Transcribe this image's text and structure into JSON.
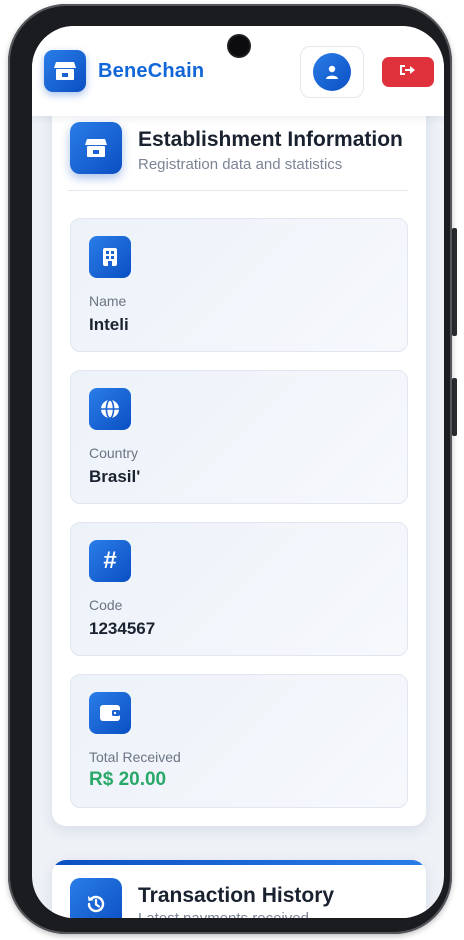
{
  "header": {
    "brand": "BeneChain",
    "logo_icon": "store-icon",
    "profile_icon": "user-icon",
    "logout_icon": "logout-icon"
  },
  "establishment": {
    "title": "Establishment Information",
    "subtitle": "Registration data and statistics",
    "fields": [
      {
        "label": "Name",
        "value": "Inteli",
        "icon": "building-icon"
      },
      {
        "label": "Country",
        "value": "Brasil'",
        "icon": "globe-icon"
      },
      {
        "label": "Code",
        "value": "1234567",
        "icon": "hash-icon"
      },
      {
        "label": "Total Received",
        "value": "R$ 20.00",
        "icon": "wallet-icon"
      }
    ]
  },
  "transactions": {
    "title": "Transaction History",
    "subtitle": "Latest payments received",
    "icon": "history-icon"
  },
  "colors": {
    "primary": "#1267d8",
    "danger": "#e0323d",
    "money": "#29a86a"
  }
}
